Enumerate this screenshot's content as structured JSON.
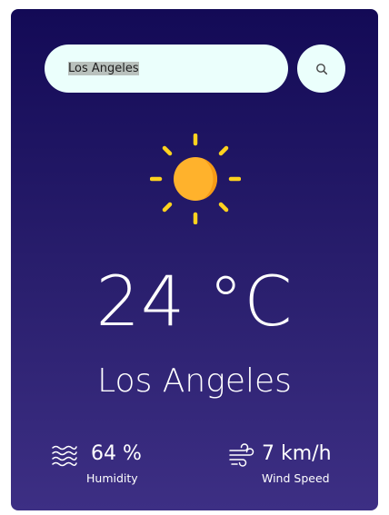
{
  "search": {
    "value": "Los Angeles",
    "icon": "search-icon"
  },
  "weather": {
    "icon": "sun-icon",
    "temperature": "24 °C",
    "city": "Los Angeles"
  },
  "details": {
    "humidity": {
      "value": "64 %",
      "label": "Humidity",
      "icon": "waves-icon"
    },
    "wind": {
      "value": "7 km/h",
      "label": "Wind Speed",
      "icon": "wind-icon"
    }
  },
  "colors": {
    "card_top": "#130a56",
    "card_bottom": "#3d2f84",
    "search_bg": "#ebfffc",
    "sun_core": "#ffb22c",
    "sun_rays": "#ffd21f",
    "text": "#ffffff"
  }
}
